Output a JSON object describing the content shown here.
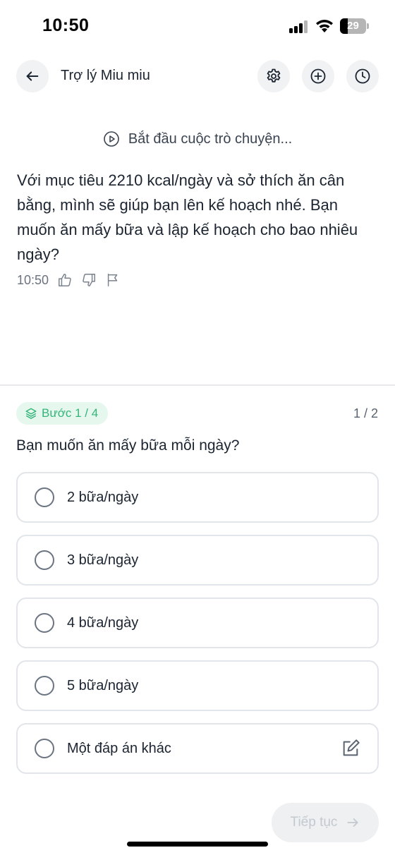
{
  "status_bar": {
    "time": "10:50",
    "battery_level": "29",
    "battery_fraction": 0.29
  },
  "header": {
    "title": "Trợ lý Miu miu",
    "icons": [
      "arrow-left-icon",
      "gear-icon",
      "plus-circle-icon",
      "clock-icon"
    ]
  },
  "chat": {
    "start_label": "Bắt đầu cuộc trò chuyện...",
    "message": "Với mục tiêu 2210 kcal/ngày và sở thích ăn cân bằng, mình sẽ giúp bạn lên kế hoạch nhé. Bạn muốn ăn mấy bữa và lập kế hoạch cho bao nhiêu ngày?",
    "message_time": "10:50",
    "meta_icons": [
      "thumbs-up-icon",
      "thumbs-down-icon",
      "flag-icon"
    ]
  },
  "question_panel": {
    "step_label": "Bước 1 / 4",
    "page_count": "1 / 2",
    "question": "Bạn muốn ăn mấy bữa mỗi ngày?",
    "options": [
      {
        "label": "2 bữa/ngày"
      },
      {
        "label": "3 bữa/ngày"
      },
      {
        "label": "4 bữa/ngày"
      },
      {
        "label": "5 bữa/ngày"
      },
      {
        "label": "Một đáp án khác"
      }
    ],
    "continue_label": "Tiếp tục"
  },
  "colors": {
    "accent_green": "#34b57a",
    "badge_bg": "#e6f7ee",
    "text_primary": "#1b2430",
    "border": "#e2e5e9"
  }
}
